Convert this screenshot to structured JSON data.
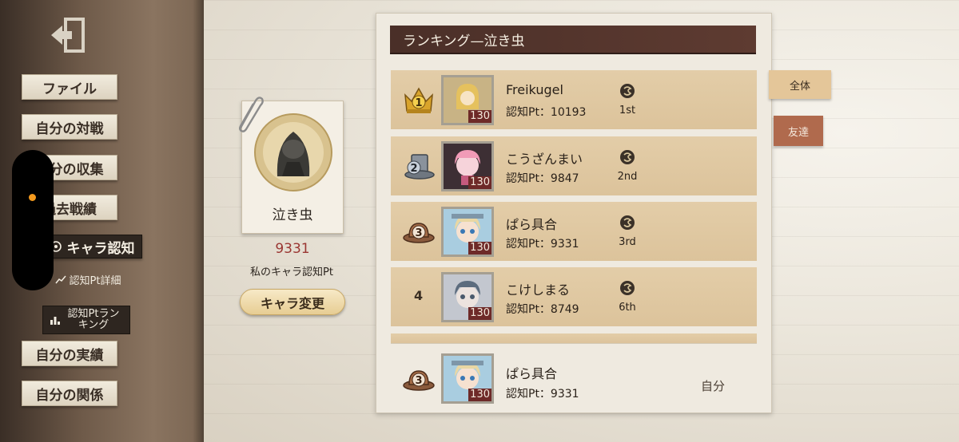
{
  "sidebar": {
    "items": [
      {
        "label": "ファイル"
      },
      {
        "label": "自分の対戦"
      },
      {
        "label": "自分の収集"
      },
      {
        "label": "過去戦績"
      },
      {
        "label": "キャラ認知"
      },
      {
        "label": "自分の実績"
      },
      {
        "label": "自分の関係"
      }
    ],
    "sub_items": [
      {
        "label": "認知Pt詳細"
      },
      {
        "label": "認知Ptランキング"
      }
    ]
  },
  "character": {
    "name": "泣き虫",
    "points": "9331",
    "points_label": "私のキャラ認知Pt",
    "change_button": "キャラ変更"
  },
  "ranking": {
    "title": "ランキング—泣き虫",
    "pt_prefix": "認知Pt：",
    "rows": [
      {
        "rank": "1",
        "name": "Freikugel",
        "points": "認知Pt：10193",
        "tier": "1st",
        "level": "130"
      },
      {
        "rank": "2",
        "name": "こうざんまい",
        "points": "認知Pt：9847",
        "tier": "2nd",
        "level": "130"
      },
      {
        "rank": "3",
        "name": "ぱら具合",
        "points": "認知Pt：9331",
        "tier": "3rd",
        "level": "130"
      },
      {
        "rank": "4",
        "name": "こけしまる",
        "points": "認知Pt：8749",
        "tier": "6th",
        "level": "130"
      }
    ],
    "self": {
      "rank": "3",
      "name": "ぱら具合",
      "points": "認知Pt：9331",
      "label": "自分",
      "level": "130"
    }
  },
  "tabs": [
    {
      "label": "全体",
      "selected": true
    },
    {
      "label": "友達",
      "selected": false
    }
  ],
  "colors": {
    "title_bar": "#4a2f28",
    "row": "#e3cda8",
    "points_red": "#9a3632",
    "active_tab": "#e4c699",
    "inactive_tab": "#b06a4d"
  }
}
